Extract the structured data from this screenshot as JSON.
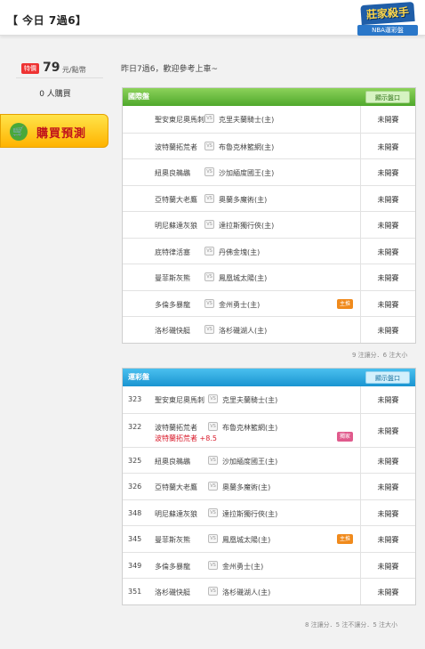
{
  "header": {
    "title": "【 今日 7過6】"
  },
  "logo": {
    "brand": "莊家殺手",
    "sub": "NBA運彩盤"
  },
  "sidebar": {
    "price_badge": "特價",
    "price": "79",
    "price_unit": "元/點幣",
    "buyers": "0 人購買",
    "buy_label": "購買預測"
  },
  "welcome": "昨日7過6，歡迎參考上車~",
  "panel1": {
    "title": "國際盤",
    "button": "顯示盤口",
    "rows": [
      {
        "team1": "聖安東尼奧馬刺",
        "team2": "克里夫蘭騎士(主)",
        "status": "未開賽",
        "tag": ""
      },
      {
        "team1": "波特蘭拓荒者",
        "team2": "布魯克林籃網(主)",
        "status": "未開賽",
        "tag": ""
      },
      {
        "team1": "紐奧良鵜鶘",
        "team2": "沙加緬度國王(主)",
        "status": "未開賽",
        "tag": ""
      },
      {
        "team1": "亞特蘭大老鷹",
        "team2": "奧蘭多魔術(主)",
        "status": "未開賽",
        "tag": ""
      },
      {
        "team1": "明尼蘇達灰狼",
        "team2": "達拉斯獨行俠(主)",
        "status": "未開賽",
        "tag": ""
      },
      {
        "team1": "底特律活塞",
        "team2": "丹佛金塊(主)",
        "status": "未開賽",
        "tag": ""
      },
      {
        "team1": "曼菲斯灰熊",
        "team2": "鳳凰城太陽(主)",
        "status": "未開賽",
        "tag": ""
      },
      {
        "team1": "多倫多暴龍",
        "team2": "金州勇士(主)",
        "status": "未開賽",
        "tag": "主推"
      },
      {
        "team1": "洛杉磯快艇",
        "team2": "洛杉磯湖人(主)",
        "status": "未開賽",
        "tag": ""
      }
    ],
    "footer": "9 注讓分．6 注大小"
  },
  "panel2": {
    "title": "運彩盤",
    "button": "顯示盤口",
    "rows": [
      {
        "num": "323",
        "team1": "聖安東尼奧馬刺",
        "team2": "克里夫蘭騎士(主)",
        "status": "未開賽",
        "tag": "",
        "pick": ""
      },
      {
        "num": "322",
        "team1": "波特蘭拓荒者",
        "team2": "布魯克林籃網(主)",
        "status": "未開賽",
        "tag": "獨家",
        "pick": "波特蘭拓荒者 +8.5"
      },
      {
        "num": "325",
        "team1": "紐奧良鵜鶘",
        "team2": "沙加緬度國王(主)",
        "status": "未開賽",
        "tag": "",
        "pick": ""
      },
      {
        "num": "326",
        "team1": "亞特蘭大老鷹",
        "team2": "奧蘭多魔術(主)",
        "status": "未開賽",
        "tag": "",
        "pick": ""
      },
      {
        "num": "348",
        "team1": "明尼蘇達灰狼",
        "team2": "達拉斯獨行俠(主)",
        "status": "未開賽",
        "tag": "",
        "pick": ""
      },
      {
        "num": "345",
        "team1": "曼菲斯灰熊",
        "team2": "鳳凰城太陽(主)",
        "status": "未開賽",
        "tag": "主推",
        "pick": ""
      },
      {
        "num": "349",
        "team1": "多倫多暴龍",
        "team2": "金州勇士(主)",
        "status": "未開賽",
        "tag": "",
        "pick": ""
      },
      {
        "num": "351",
        "team1": "洛杉磯快艇",
        "team2": "洛杉磯湖人(主)",
        "status": "未開賽",
        "tag": "",
        "pick": ""
      }
    ],
    "footer": "8 注讓分．5 注不讓分．5 注大小"
  },
  "vs_label": "VS",
  "colors": {
    "accent_green": "#4fa82c",
    "accent_blue": "#1a94d1",
    "buy_yellow": "#ffb300",
    "pick_red": "#d91a2a"
  }
}
